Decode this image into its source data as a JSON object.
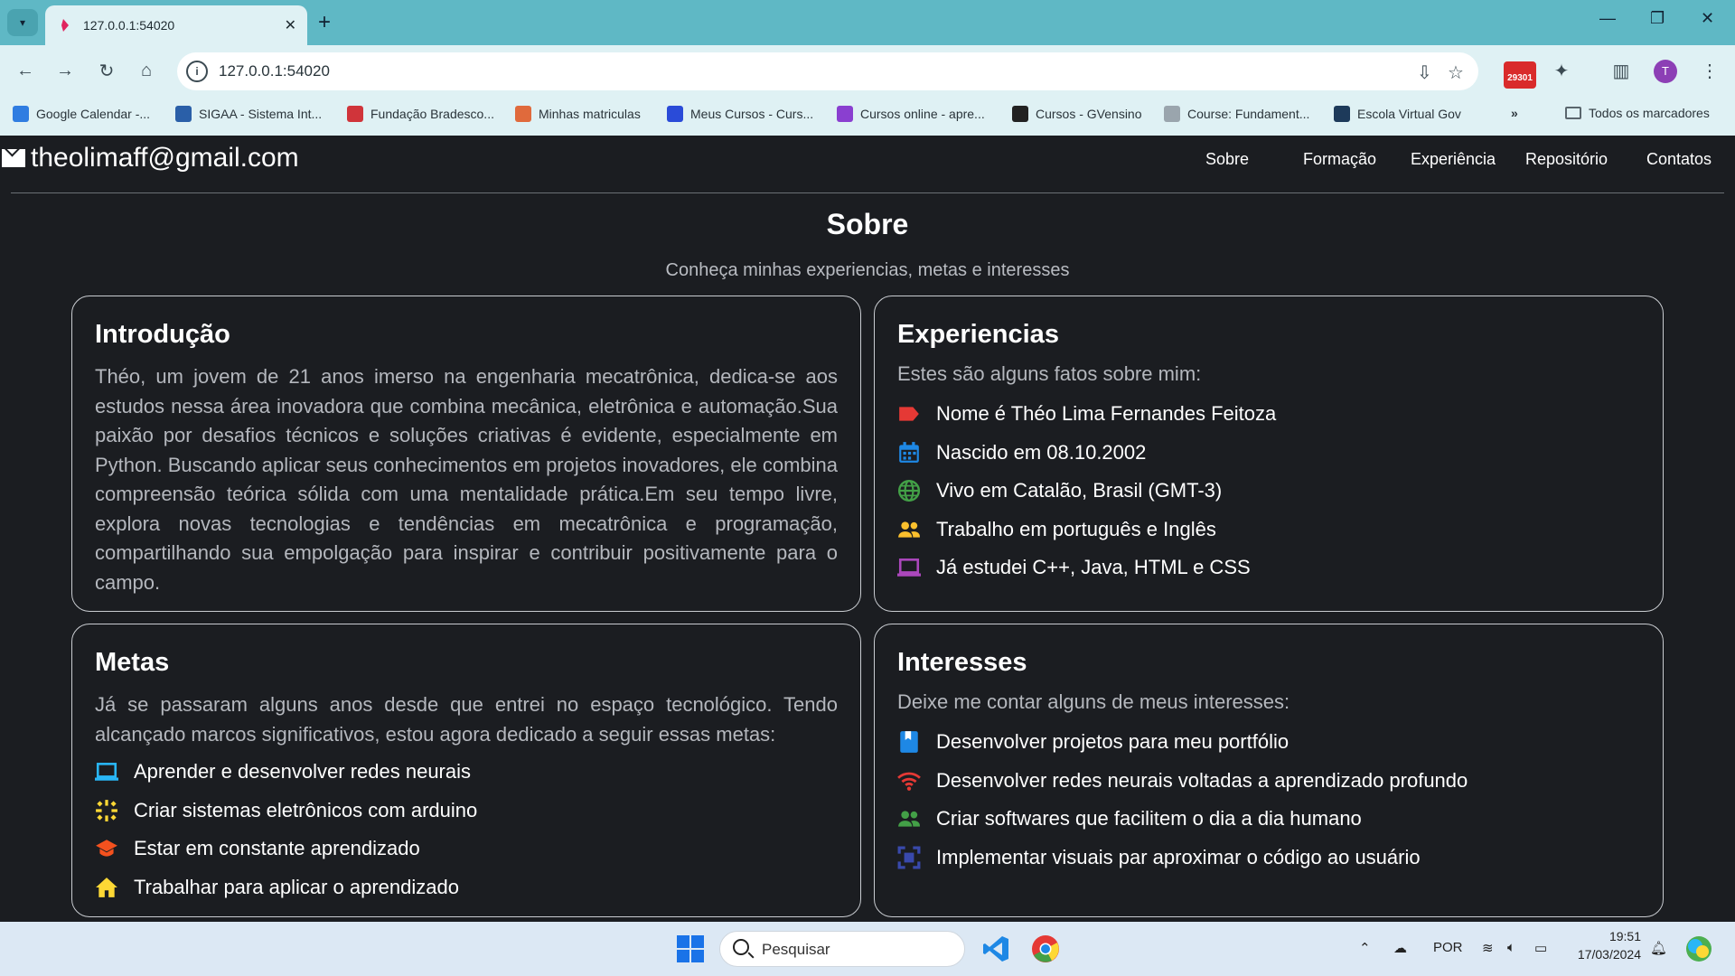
{
  "browser": {
    "tab_title": "127.0.0.1:54020",
    "url": "127.0.0.1:54020",
    "extension_badge": "29301",
    "profile_initial": "T",
    "bookmarks": [
      {
        "label": "Google Calendar -...",
        "color": "#2f7de1"
      },
      {
        "label": "SIGAA - Sistema Int...",
        "color": "#2a5fa8"
      },
      {
        "label": "Fundação Bradesco...",
        "color": "#d0343a"
      },
      {
        "label": "Minhas matriculas",
        "color": "#e06a3c"
      },
      {
        "label": "Meus Cursos - Curs...",
        "color": "#2a4bd8"
      },
      {
        "label": "Cursos online - apre...",
        "color": "#8a3fd0"
      },
      {
        "label": "Cursos - GVensino",
        "color": "#222222"
      },
      {
        "label": "Course: Fundament...",
        "color": "#9aa5ad"
      },
      {
        "label": "Escola Virtual Gov",
        "color": "#1d3a5a"
      }
    ],
    "all_bookmarks": "Todos os marcadores"
  },
  "site": {
    "email": "theolimaff@gmail.com",
    "nav": [
      "Sobre",
      "Formação",
      "Experiência",
      "Repositório",
      "Contatos"
    ],
    "section_title": "Sobre",
    "section_subtitle": "Conheça minhas experiencias, metas e interesses",
    "intro": {
      "title": "Introdução",
      "text": "Théo, um jovem de 21 anos imerso na engenharia mecatrônica, dedica-se aos estudos nessa área inovadora que combina mecânica, eletrônica e automação.Sua paixão por desafios técnicos e soluções criativas é evidente, especialmente em Python. Buscando aplicar seus conhecimentos em projetos inovadores, ele combina compreensão teórica sólida com uma mentalidade prática.Em seu tempo livre, explora novas tecnologias e tendências em mecatrônica e programação, compartilhando sua empolgação para inspirar e contribuir positivamente para o campo."
    },
    "experiences": {
      "title": "Experiencias",
      "lead": "Estes são alguns fatos sobre mim:",
      "items": [
        {
          "text": "Nome é Théo Lima Fernandes Feitoza",
          "icon": "label-icon",
          "color": "#e53935"
        },
        {
          "text": "Nascido em 08.10.2002",
          "icon": "calendar-icon",
          "color": "#1e88e5"
        },
        {
          "text": "Vivo em Catalão, Brasil (GMT-3)",
          "icon": "globe-icon",
          "color": "#43a047"
        },
        {
          "text": "Trabalho em português e Inglês",
          "icon": "people-icon",
          "color": "#fbc02d"
        },
        {
          "text": "Já estudei C++, Java, HTML e CSS",
          "icon": "laptop-icon",
          "color": "#ab47bc"
        }
      ]
    },
    "goals": {
      "title": "Metas",
      "text": "Já se passaram alguns anos desde que entrei no espaço tecnológico. Tendo alcançado marcos significativos, estou agora dedicado a seguir essas metas:",
      "items": [
        {
          "text": "Aprender e desenvolver redes neurais",
          "icon": "laptop-icon",
          "color": "#29b6f6"
        },
        {
          "text": "Criar sistemas eletrônicos com arduino",
          "icon": "sparkle-icon",
          "color": "#fdd835"
        },
        {
          "text": "Estar em constante aprendizado",
          "icon": "graduation-cap-icon",
          "color": "#f4511e"
        },
        {
          "text": "Trabalhar para aplicar o aprendizado",
          "icon": "home-icon",
          "color": "#fdd835"
        }
      ]
    },
    "interests": {
      "title": "Interesses",
      "lead": "Deixe me contar alguns de meus interesses:",
      "items": [
        {
          "text": "Desenvolver projetos para meu portfólio",
          "icon": "bookmark-icon",
          "color": "#1e88e5"
        },
        {
          "text": "Desenvolver redes neurais voltadas a aprendizado profundo",
          "icon": "wifi-icon",
          "color": "#e53935"
        },
        {
          "text": "Criar softwares que facilitem o dia a dia humano",
          "icon": "people-icon",
          "color": "#43a047"
        },
        {
          "text": "Implementar visuais par aproximar o código ao usuário",
          "icon": "frame-icon",
          "color": "#3949ab"
        }
      ]
    }
  },
  "taskbar": {
    "search_placeholder": "Pesquisar",
    "language": "POR",
    "time": "19:51",
    "date": "17/03/2024"
  }
}
